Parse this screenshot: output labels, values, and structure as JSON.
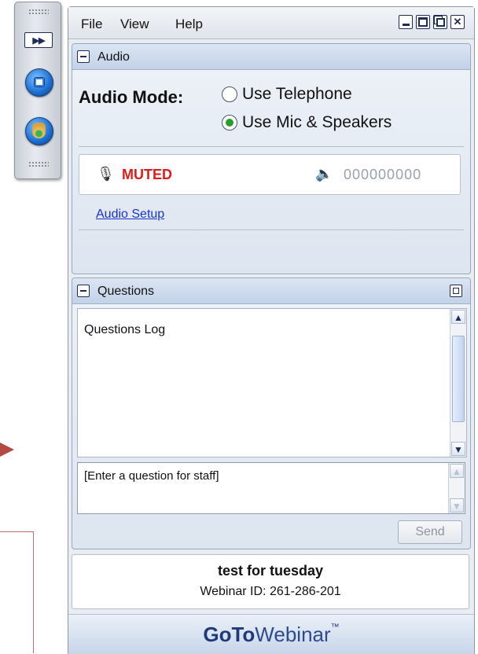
{
  "menu": {
    "file": "File",
    "view": "View",
    "help": "Help"
  },
  "audio": {
    "panel_title": "Audio",
    "mode_label": "Audio Mode:",
    "option_telephone": "Use Telephone",
    "option_mic": "Use Mic & Speakers",
    "selected_option": "Use Mic & Speakers",
    "mute_status": "MUTED",
    "audio_pin": "000000000",
    "setup_link": "Audio Setup"
  },
  "questions": {
    "panel_title": "Questions",
    "log_text": "Questions Log",
    "input_placeholder": "[Enter a question for staff]",
    "send_label": "Send"
  },
  "webinar": {
    "title": "test for tuesday",
    "id_text": "Webinar ID: 261-286-201"
  },
  "brand": {
    "bold": "GoTo",
    "light": "Webinar",
    "mark": "™"
  },
  "colors": {
    "muted": "#e01b1b",
    "link": "#1a33cc",
    "brand": "#1f3a78",
    "radio_selected": "#2a9d2a"
  },
  "icons": [
    "expand-arrows-icon",
    "screen-icon",
    "raise-hand-icon",
    "microphone-icon",
    "speaker-icon",
    "minimize-icon",
    "maximize-icon",
    "restore-icon",
    "close-icon",
    "collapse-icon",
    "popout-icon"
  ]
}
